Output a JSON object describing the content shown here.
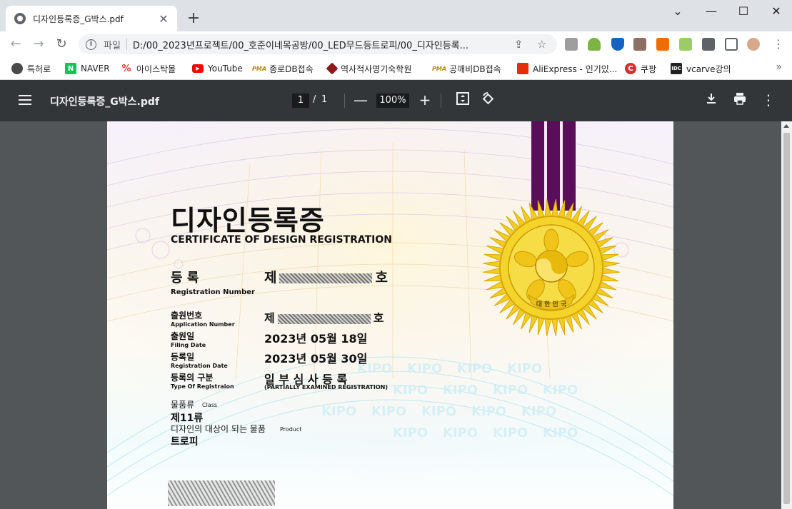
{
  "browser": {
    "tab_title": "디자인등록증_G박스.pdf",
    "tab_close": "✕",
    "new_tab": "+",
    "window_controls": {
      "minimize": "⌄",
      "restore": "—",
      "maximize": "☐",
      "close": "✕"
    },
    "address_prefix": "파일",
    "address_url": "D:/00_2023년프로젝트/00_호준이네목공방/00_LED무드등트로피/00_디자인등록...",
    "bookmarks": [
      {
        "label": "특허로",
        "icon": "patent-icon",
        "color": "#4a4a4a"
      },
      {
        "label": "NAVER",
        "icon": "naver-icon",
        "color": "#03c75a"
      },
      {
        "label": "아이스탁몰",
        "icon": "istock-icon",
        "color": "#e53935"
      },
      {
        "label": "YouTube",
        "icon": "youtube-icon",
        "color": "#ff0000"
      },
      {
        "label": "종로DB접속",
        "icon": "pma-icon",
        "color": "#d4a017"
      },
      {
        "label": "역사적사명기숙학원",
        "icon": "academy-icon",
        "color": "#8b1a1a"
      },
      {
        "label": "공깨비DB접속",
        "icon": "pma-icon",
        "color": "#d4a017"
      },
      {
        "label": "AliExpress - 인기있...",
        "icon": "aliexpress-icon",
        "color": "#e62e04"
      },
      {
        "label": "쿠팡",
        "icon": "coupang-icon",
        "color": "#d32f2f"
      },
      {
        "label": "vcarve강의",
        "icon": "idc-icon",
        "color": "#222222"
      }
    ],
    "bookmarks_more": "»"
  },
  "viewer": {
    "title": "디자인등록증_G박스.pdf",
    "page_current": "1",
    "page_sep": "/",
    "page_total": "1",
    "zoom": "100%",
    "zoom_out": "—",
    "zoom_in": "+"
  },
  "certificate": {
    "title_ko": "디자인등록증",
    "title_en": "CERTIFICATE OF DESIGN REGISTRATION",
    "reg_label_ko": "등 록",
    "reg_label_en": "Registration Number",
    "reg_prefix": "제",
    "reg_suffix": "호",
    "app_label_ko": "출원번호",
    "app_label_en": "Application Number",
    "app_prefix": "제",
    "app_suffix": "호",
    "filing_label_ko": "출원일",
    "filing_label_en": "Filing Date",
    "filing_value": "2023년  05월  18일",
    "regdate_label_ko": "등록일",
    "regdate_label_en": "Registration Date",
    "regdate_value": "2023년  05월  30일",
    "type_label_ko": "등록의 구분",
    "type_label_en": "Type Of Registraion",
    "type_value": "일 부 심 사 등 록",
    "type_value_en": "(PARTIALLY EXAMINED REGISTRATION)",
    "class_label_ko": "물품류",
    "class_label_en": "Class",
    "class_value": "제11류",
    "product_label_ko": "디자인의 대상이 되는 물품",
    "product_label_en": "Product",
    "product_value": "트로피",
    "seal_text": "대 한 민 국",
    "watermark": "KIPO"
  },
  "colors": {
    "ribbon": "#5a0d58",
    "seal_gold": "#f2cc1f",
    "pdf_toolbar": "#323639",
    "viewer_bg": "#525659"
  }
}
